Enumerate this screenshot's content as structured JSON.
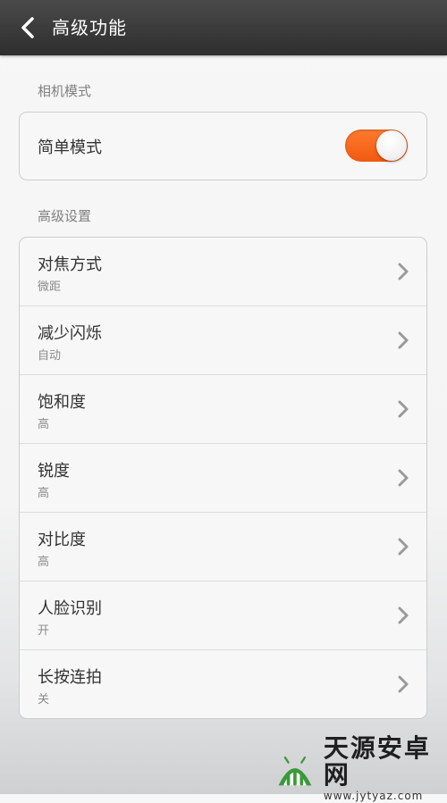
{
  "header": {
    "title": "高级功能",
    "back_icon": "chevron-left-icon"
  },
  "sections": {
    "camera_mode": {
      "header": "相机模式",
      "simple_mode": {
        "label": "简单模式",
        "enabled": true,
        "accent_color": "#f26418"
      }
    },
    "advanced": {
      "header": "高级设置",
      "items": [
        {
          "title": "对焦方式",
          "value": "微距"
        },
        {
          "title": "减少闪烁",
          "value": "自动"
        },
        {
          "title": "饱和度",
          "value": "高"
        },
        {
          "title": "锐度",
          "value": "高"
        },
        {
          "title": "对比度",
          "value": "高"
        },
        {
          "title": "人脸识别",
          "value": "开"
        },
        {
          "title": "长按连拍",
          "value": "关"
        }
      ]
    }
  },
  "watermark": {
    "name": "天源安卓网",
    "url": "www.jytyaz.com"
  }
}
